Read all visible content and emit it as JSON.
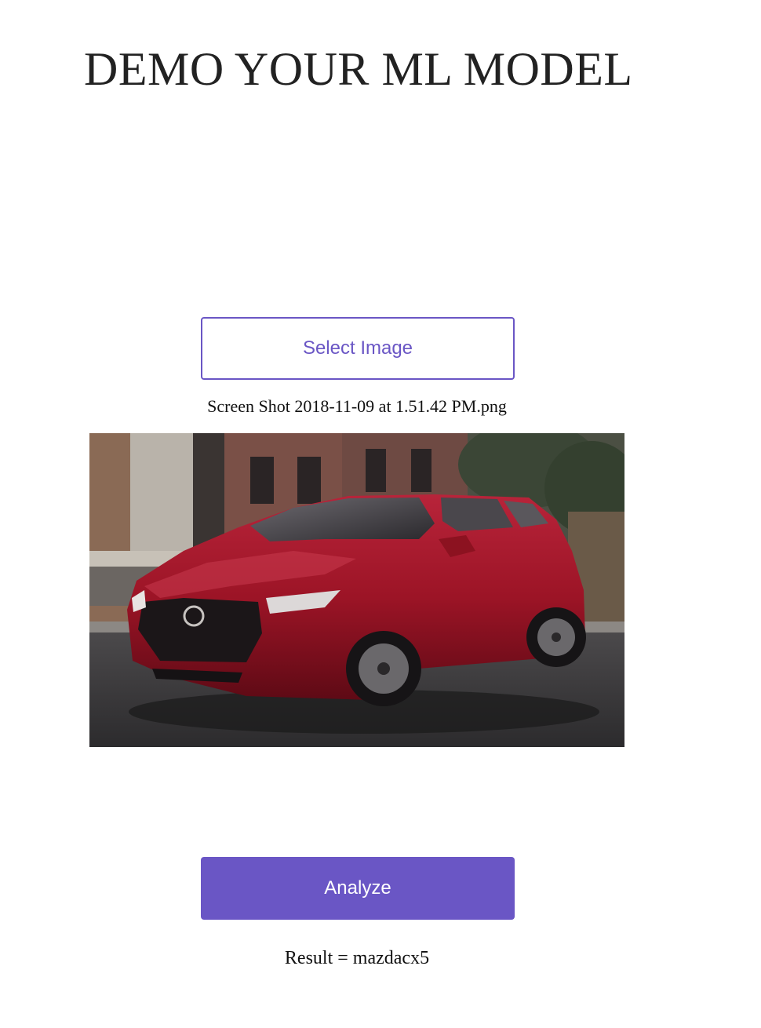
{
  "header": {
    "title": "DEMO YOUR ML MODEL"
  },
  "upload": {
    "select_label": "Select Image",
    "file_name": "Screen Shot 2018-11-09 at 1.51.42 PM.png"
  },
  "preview": {
    "image": "red-mazda-cx5-suv-photo"
  },
  "actions": {
    "analyze_label": "Analyze"
  },
  "result": {
    "text": "Result = mazdacx5"
  },
  "colors": {
    "accent": "#6a56c5",
    "title_text": "#222222",
    "body_text": "#111111"
  }
}
